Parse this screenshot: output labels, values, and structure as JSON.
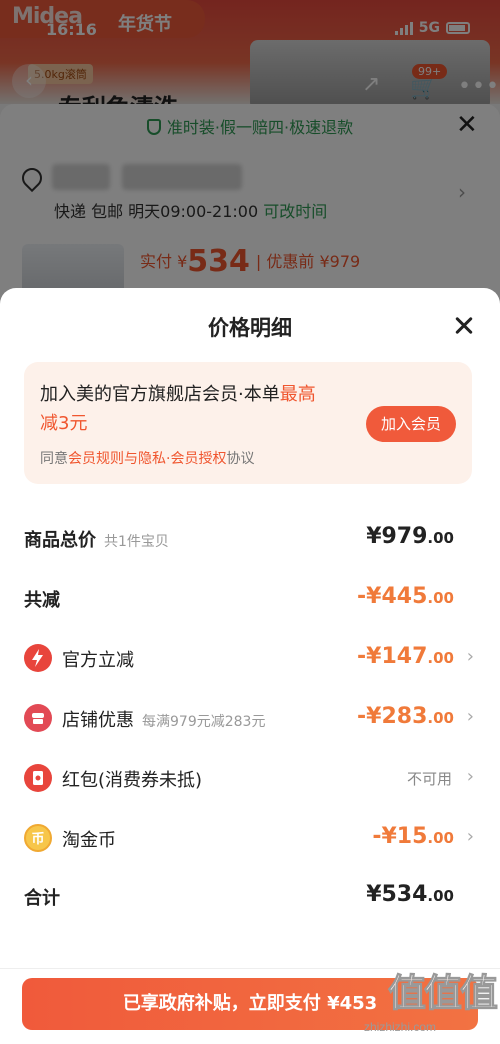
{
  "background": {
    "brand": "Midea",
    "festival": "年货节",
    "time": "16:16",
    "network": "5G",
    "cart_badge": "99+",
    "back_icon": "back-arrow-icon",
    "share_icon": "share-icon",
    "cart_icon": "cart-icon",
    "more_icon": "more-dots-icon",
    "promo_tag": "5.0kg滚筒",
    "product_title": "专利免清洗",
    "guarantee": "准时装·假一赔四·极速退款",
    "delivery": "快递 包邮 明天09:00-21:00",
    "delivery_link": "可改时间",
    "pay_label": "实付 ¥",
    "pay_value": "534",
    "pay_before": "| 优惠前 ¥979"
  },
  "sheet": {
    "title": "价格明细",
    "close_icon": "close-icon",
    "member": {
      "text_prefix": "加入美的官方旗舰店会员·本单",
      "text_highlight": "最高减3元",
      "button": "加入会员",
      "agree_prefix": "同意",
      "agree_link": "会员规则与隐私·会员授权",
      "agree_suffix": "协议"
    },
    "rows": {
      "total": {
        "label": "商品总价",
        "sub": "共1件宝贝",
        "amount": "¥979",
        "cents": ".00"
      },
      "reduce": {
        "label": "共减",
        "amount": "-¥445",
        "cents": ".00"
      },
      "official": {
        "label": "官方立减",
        "amount": "-¥147",
        "cents": ".00"
      },
      "store": {
        "label": "店铺优惠",
        "sub": "每满979元减283元",
        "amount": "-¥283",
        "cents": ".00"
      },
      "redpacket": {
        "label": "红包(消费券未抵)",
        "status": "不可用"
      },
      "coin": {
        "label": "淘金币",
        "amount": "-¥15",
        "cents": ".00"
      },
      "sum": {
        "label": "合计",
        "amount": "¥534",
        "cents": ".00"
      }
    },
    "pay_button": "已享政府补贴，立即支付 ¥453",
    "watermark_site": "zhizhizhi.com",
    "watermark_mark": "值值值"
  },
  "colors": {
    "accent": "#f05a3b",
    "discount": "#f07a3a",
    "green": "#2f9a55",
    "member_bg": "#fdf1ea"
  }
}
